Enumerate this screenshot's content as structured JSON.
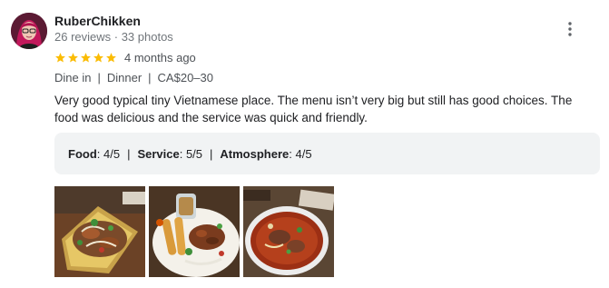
{
  "reviewer": {
    "name": "RuberChikken",
    "meta": "26 reviews · 33 photos",
    "avatar_icon": "avatar-photo"
  },
  "rating": {
    "stars": 5,
    "max_stars": 5,
    "star_color": "#fbbc04",
    "time": "4 months ago"
  },
  "attributes": [
    "Dine in",
    "Dinner",
    "CA$20–30"
  ],
  "review_text": "Very good typical tiny Vietnamese place. The menu isn’t very big but still has good choices. The food was delicious and the service was quick and friendly.",
  "sub_ratings": [
    {
      "label": "Food",
      "value": ": 4/5"
    },
    {
      "label": "Service",
      "value": ": 5/5"
    },
    {
      "label": "Atmosphere",
      "value": ": 4/5"
    }
  ],
  "menu_icon": "more-vert-icon",
  "photos": [
    {
      "icon": "food-photo-salad"
    },
    {
      "icon": "food-photo-spring-rolls"
    },
    {
      "icon": "food-photo-soup"
    }
  ]
}
